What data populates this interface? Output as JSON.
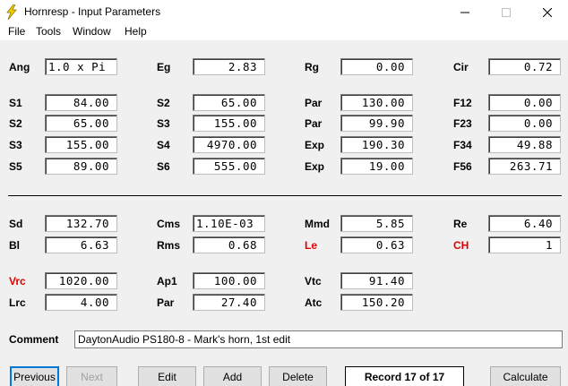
{
  "window": {
    "title": "Hornresp - Input Parameters",
    "icon": "lightning-bolt-icon"
  },
  "menu": [
    "File",
    "Tools",
    "Window",
    "Help"
  ],
  "params": {
    "ang": {
      "label": "Ang",
      "value": "1.0 x Pi"
    },
    "eg": {
      "label": "Eg",
      "value": "2.83"
    },
    "rg": {
      "label": "Rg",
      "value": "0.00"
    },
    "cir": {
      "label": "Cir",
      "value": "0.72"
    },
    "s1": {
      "label": "S1",
      "value": "84.00"
    },
    "s2a": {
      "label": "S2",
      "value": "65.00"
    },
    "par1": {
      "label": "Par",
      "value": "130.00"
    },
    "f12": {
      "label": "F12",
      "value": "0.00"
    },
    "s2b": {
      "label": "S2",
      "value": "65.00"
    },
    "s3a": {
      "label": "S3",
      "value": "155.00"
    },
    "par2": {
      "label": "Par",
      "value": "99.90"
    },
    "f23": {
      "label": "F23",
      "value": "0.00"
    },
    "s3b": {
      "label": "S3",
      "value": "155.00"
    },
    "s4": {
      "label": "S4",
      "value": "4970.00"
    },
    "exp1": {
      "label": "Exp",
      "value": "190.30"
    },
    "f34": {
      "label": "F34",
      "value": "49.88"
    },
    "s5": {
      "label": "S5",
      "value": "89.00"
    },
    "s6": {
      "label": "S6",
      "value": "555.00"
    },
    "exp2": {
      "label": "Exp",
      "value": "19.00"
    },
    "f56": {
      "label": "F56",
      "value": "263.71"
    },
    "sd": {
      "label": "Sd",
      "value": "132.70"
    },
    "cms": {
      "label": "Cms",
      "value": "1.10E-03"
    },
    "mmd": {
      "label": "Mmd",
      "value": "5.85"
    },
    "re": {
      "label": "Re",
      "value": "6.40"
    },
    "bl": {
      "label": "Bl",
      "value": "6.63"
    },
    "rms": {
      "label": "Rms",
      "value": "0.68"
    },
    "le": {
      "label": "Le",
      "value": "0.63"
    },
    "ch": {
      "label": "CH",
      "value": "1"
    },
    "vrc": {
      "label": "Vrc",
      "value": "1020.00"
    },
    "ap1": {
      "label": "Ap1",
      "value": "100.00"
    },
    "vtc": {
      "label": "Vtc",
      "value": "91.40"
    },
    "lrc": {
      "label": "Lrc",
      "value": "4.00"
    },
    "par3": {
      "label": "Par",
      "value": "27.40"
    },
    "atc": {
      "label": "Atc",
      "value": "150.20"
    }
  },
  "comment": {
    "label": "Comment",
    "value": "DaytonAudio PS180-8 - Mark's horn, 1st edit"
  },
  "buttons": {
    "previous": "Previous",
    "next": "Next",
    "edit": "Edit",
    "add": "Add",
    "delete": "Delete",
    "calculate": "Calculate"
  },
  "record": "Record 17 of 17",
  "colors": {
    "highlight_label": "#e00000",
    "default_button_border": "#0078d7",
    "icon": "#f5d000"
  }
}
